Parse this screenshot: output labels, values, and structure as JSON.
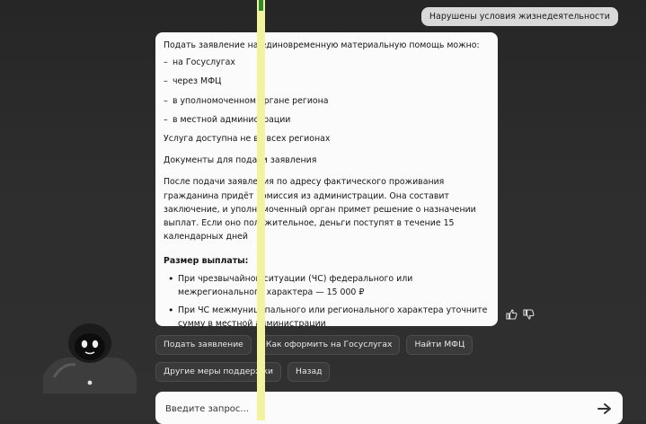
{
  "user_message": "Нарушены условия жизнедеятельности",
  "bot_message": {
    "intro": "Подать заявление на единовременную материальную помощь можно:",
    "methods": [
      "на Госуслугах",
      "через МФЦ",
      "в уполномоченном органе региона",
      "в местной администрации"
    ],
    "availability": "Услуга доступна не во всех регионах",
    "documents_link": "Документы для подачи заявления",
    "process": "После подачи заявления по адресу фактического проживания гражданина придёт комиссия из администрации. Она составит заключение, и уполномоченный орган примет решение о назначении выплат. Если оно положительное, деньги поступят в течение 15 календарных дней",
    "payment_title": "Размер выплаты:",
    "payments": [
      "При чрезвычайной ситуации (ЧС) федерального или межрегионального характера — 15 000 ₽",
      "При ЧС межмуниципального или регионального характера уточните сумму в местной администрации"
    ]
  },
  "feedback": {
    "like_icon": "thumbs-up-icon",
    "dislike_icon": "thumbs-down-icon"
  },
  "quick_replies": {
    "row1": [
      "Подать заявление",
      "Как оформить на Госуслугах",
      "Найти МФЦ"
    ],
    "row2": [
      "Другие меры поддержки",
      "Назад"
    ]
  },
  "input": {
    "placeholder": "Введите запрос...",
    "value": ""
  },
  "colors": {
    "background": "#2c2c2c",
    "card": "#fbfbfb",
    "chip": "#3a3a3a",
    "overlay_stripe": "#f2f2a0"
  }
}
